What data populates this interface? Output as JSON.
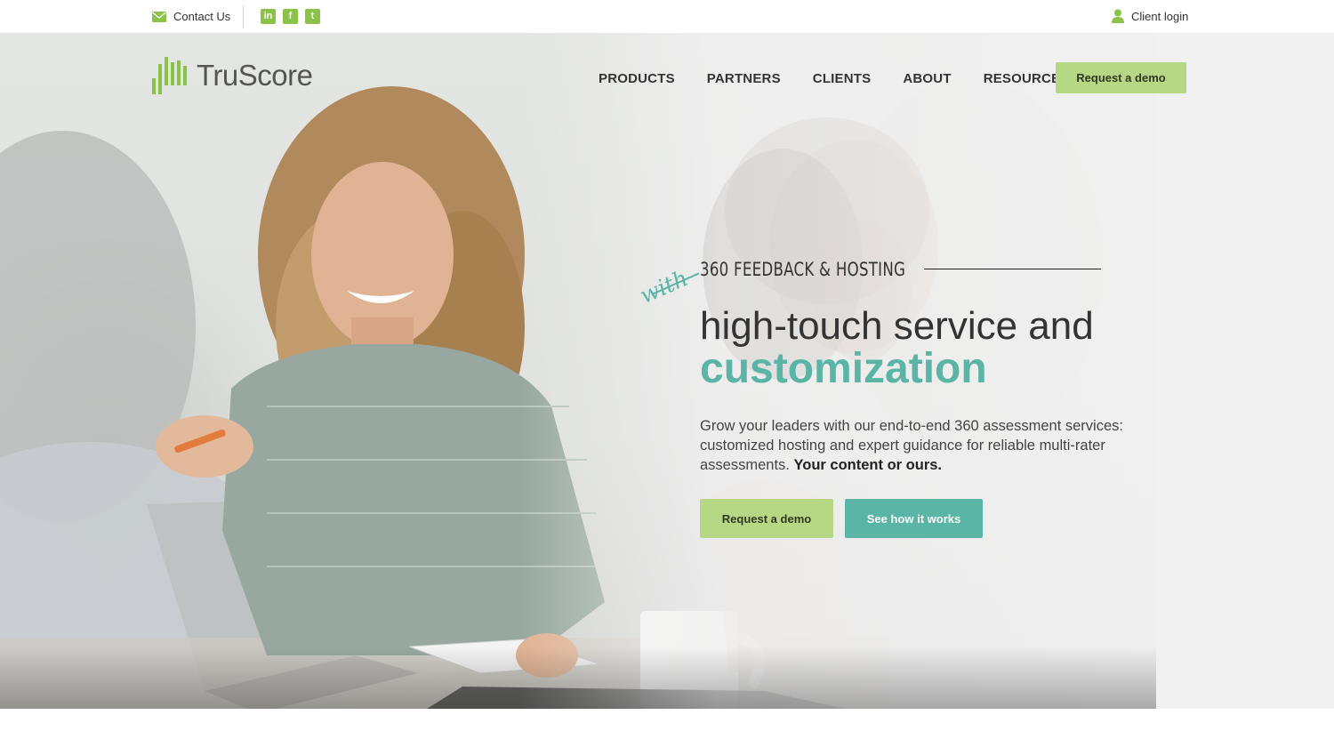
{
  "topbar": {
    "contact_label": "Contact Us",
    "social": [
      {
        "name": "linkedin-icon",
        "glyph": "in"
      },
      {
        "name": "facebook-icon",
        "glyph": "f"
      },
      {
        "name": "twitter-icon",
        "glyph": "t"
      }
    ],
    "client_login_label": "Client login"
  },
  "brand": {
    "name_part1": "Tru",
    "name_part2": "Score",
    "accent_green": "#8bc34a",
    "light_green": "#b6d884",
    "teal": "#5ab5a6"
  },
  "nav": {
    "items": [
      "PRODUCTS",
      "PARTNERS",
      "CLIENTS",
      "ABOUT",
      "RESOURCES"
    ],
    "cta_label": "Request a demo"
  },
  "hero": {
    "eyebrow": "360 FEEDBACK & HOSTING",
    "script_word": "with",
    "headline_line1": "high-touch service and",
    "headline_line2": "customization",
    "description_plain": "Grow your leaders with our end-to-end 360 assessment services: customized hosting and expert guidance for reliable multi-rater assessments. ",
    "description_bold": "Your content or ours.",
    "primary_cta": "Request a demo",
    "secondary_cta": "See how it works"
  }
}
